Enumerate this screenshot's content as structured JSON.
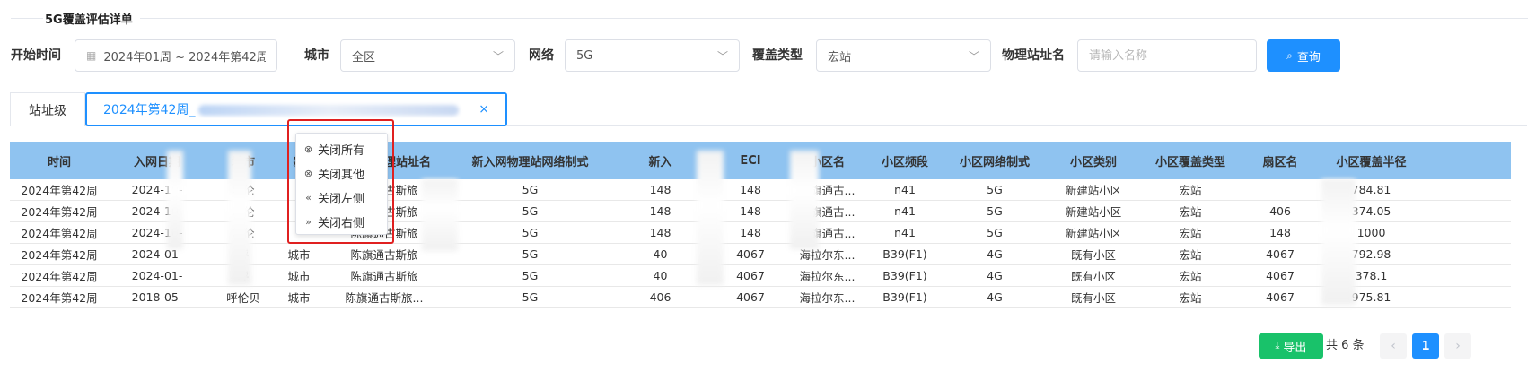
{
  "section_title": "5G覆盖评估详单",
  "filters": {
    "start_time_label": "开始时间",
    "start_time_value": "2024年01周 ~ 2024年第42周",
    "city_label": "城市",
    "city_value": "全区",
    "network_label": "网络",
    "network_value": "5G",
    "coverage_type_label": "覆盖类型",
    "coverage_type_value": "宏站",
    "site_name_label": "物理站址名",
    "site_name_placeholder": "请输入名称",
    "query_button": "查询"
  },
  "tabs": [
    {
      "label": "站址级"
    },
    {
      "label": "2024年第42周_"
    }
  ],
  "context_menu": [
    {
      "label": "关闭所有",
      "icon": "close-circle-filled-icon"
    },
    {
      "label": "关闭其他",
      "icon": "close-circle-icon"
    },
    {
      "label": "关闭左侧",
      "icon": "double-left-icon"
    },
    {
      "label": "关闭右侧",
      "icon": "double-right-icon"
    }
  ],
  "table": {
    "columns": [
      "时间",
      "入网日期",
      "城市",
      "新",
      "新入网物理站址名",
      "新入网物理站网络制式",
      "新入",
      "ECI",
      "小区名",
      "小区频段",
      "小区网络制式",
      "小区类别",
      "小区覆盖类型",
      "扇区名",
      "小区覆盖半径"
    ],
    "rows": [
      [
        "2024年第42周",
        "2024-10-",
        "呼伦",
        "",
        "陈旗通古斯旅",
        "5G",
        "148",
        "148",
        "陈旗通古...",
        "n41",
        "5G",
        "新建站小区",
        "宏站",
        "",
        "784.81"
      ],
      [
        "2024年第42周",
        "2024-10-",
        "呼伦",
        "",
        "陈旗通古斯旅",
        "5G",
        "148",
        "148",
        "陈旗通古...",
        "n41",
        "5G",
        "新建站小区",
        "宏站",
        "406",
        "374.05"
      ],
      [
        "2024年第42周",
        "2024-10-",
        "呼伦",
        "",
        "陈旗通古斯旅",
        "5G",
        "148",
        "148",
        "陈旗通古...",
        "n41",
        "5G",
        "新建站小区",
        "宏站",
        "148",
        "1000"
      ],
      [
        "2024年第42周",
        "2024-01-",
        "呼",
        "城市",
        "陈旗通古斯旅",
        "5G",
        "40",
        "4067",
        "海拉尔东...",
        "B39(F1)",
        "4G",
        "既有小区",
        "宏站",
        "4067",
        "792.98"
      ],
      [
        "2024年第42周",
        "2024-01-",
        "呼",
        "城市",
        "陈旗通古斯旅",
        "5G",
        "40",
        "4067",
        "海拉尔东...",
        "B39(F1)",
        "4G",
        "既有小区",
        "宏站",
        "4067",
        "378.1"
      ],
      [
        "2024年第42周",
        "2018-05-",
        "呼伦贝",
        "城市",
        "陈旗通古斯旅...",
        "5G",
        "406",
        "4067",
        "海拉尔东...",
        "B39(F1)",
        "4G",
        "既有小区",
        "宏站",
        "4067",
        "975.81"
      ]
    ]
  },
  "footer": {
    "export_button": "导出",
    "total_text": "共 6 条",
    "current_page": "1"
  }
}
